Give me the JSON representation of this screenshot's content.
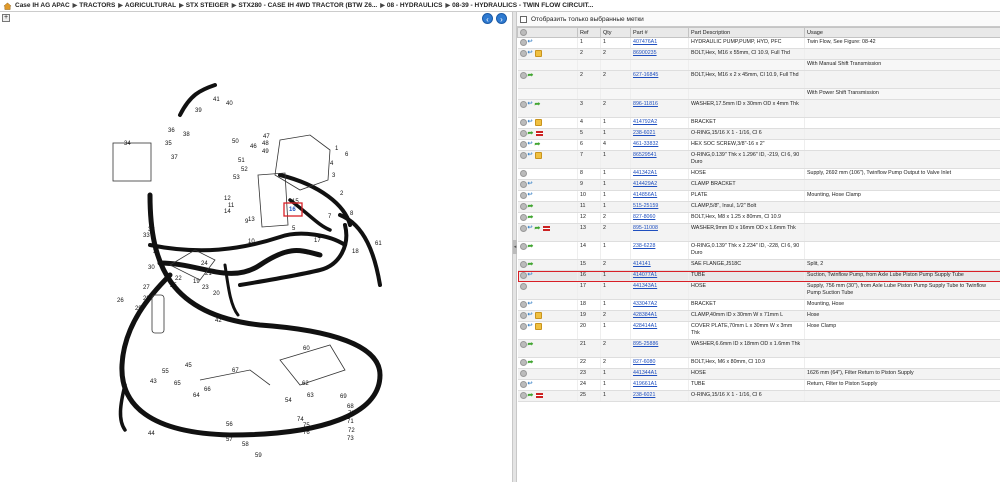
{
  "breadcrumb": [
    "Case IH AG APAC",
    "TRACTORS",
    "AGRICULTURAL",
    "STX STEIGER",
    "STX280 - CASE IH 4WD TRACTOR (BTW Z6...",
    "08 - HYDRAULICS",
    "08-39 - HYDRAULICS - TWIN FLOW CIRCUIT..."
  ],
  "filter_label": "Отобразить только выбранные метки",
  "columns": [
    "Ref",
    "Qty",
    "Part #",
    "Part Description",
    "Usage"
  ],
  "rows": [
    {
      "type": "part",
      "icons": [
        "info",
        "return"
      ],
      "ref": "1",
      "qty": "1",
      "part": "407476A1",
      "desc": "HYDRAULIC PUMP,PUMP, HYD, PFC",
      "usage": "Twin Flow, See Figure: 08-42"
    },
    {
      "type": "part",
      "icons": [
        "info",
        "return",
        "box"
      ],
      "ref": "2",
      "qty": "2",
      "part": "86900235",
      "desc": "BOLT,Hex, M16 x 55mm, Cl 10.9, Full Thd",
      "usage": ""
    },
    {
      "type": "note",
      "usage": "With Manual Shift Transmission"
    },
    {
      "type": "part",
      "tall": true,
      "icons": [
        "info",
        "arrow"
      ],
      "ref": "2",
      "qty": "2",
      "part": "627-16845",
      "desc": "BOLT,Hex, M16 x 2 x 45mm, Cl 10.9, Full Thd",
      "usage": ""
    },
    {
      "type": "note",
      "usage": "With Power Shift Transmission"
    },
    {
      "type": "part",
      "tall": true,
      "icons": [
        "info",
        "return",
        "arrow"
      ],
      "ref": "3",
      "qty": "2",
      "part": "896-11816",
      "desc": "WASHER,17.5mm ID x 30mm OD x 4mm Thk",
      "usage": ""
    },
    {
      "type": "part",
      "icons": [
        "info",
        "return",
        "box"
      ],
      "ref": "4",
      "qty": "1",
      "part": "414792A2",
      "desc": "BRACKET",
      "usage": ""
    },
    {
      "type": "part",
      "icons": [
        "info",
        "arrow",
        "flag"
      ],
      "ref": "5",
      "qty": "1",
      "part": "238-6021",
      "desc": "O-RING,15/16 X 1 - 1/16, Cl 6",
      "usage": ""
    },
    {
      "type": "part",
      "icons": [
        "info",
        "return",
        "arrow"
      ],
      "ref": "6",
      "qty": "4",
      "part": "461-33832",
      "desc": "HEX SOC SCREW,3/8\"-16 x 2\"",
      "usage": ""
    },
    {
      "type": "part",
      "tall": true,
      "icons": [
        "info",
        "return",
        "box"
      ],
      "ref": "7",
      "qty": "1",
      "part": "86529541",
      "desc": "O-RING,0.139\" Thk x 1.296\" ID, -219, Cl 6, 90 Duro",
      "usage": ""
    },
    {
      "type": "part",
      "icons": [
        "info"
      ],
      "ref": "8",
      "qty": "1",
      "part": "441342A1",
      "desc": "HOSE",
      "usage": "Supply, 2692 mm (106\"), Twinflow Pump Output to Valve Inlet"
    },
    {
      "type": "part",
      "icons": [
        "info",
        "return"
      ],
      "ref": "9",
      "qty": "1",
      "part": "414429A2",
      "desc": "CLAMP BRACKET",
      "usage": ""
    },
    {
      "type": "part",
      "icons": [
        "info",
        "return"
      ],
      "ref": "10",
      "qty": "1",
      "part": "414856A1",
      "desc": "PLATE",
      "usage": "Mounting, Hose Clamp"
    },
    {
      "type": "part",
      "icons": [
        "info",
        "arrow"
      ],
      "ref": "11",
      "qty": "1",
      "part": "515-25159",
      "desc": "CLAMP,5/8\", Insul, 1/2\" Bolt",
      "usage": ""
    },
    {
      "type": "part",
      "icons": [
        "info",
        "arrow"
      ],
      "ref": "12",
      "qty": "2",
      "part": "827-8060",
      "desc": "BOLT,Hex, M8 x 1.25 x 80mm, Cl 10.9",
      "usage": ""
    },
    {
      "type": "part",
      "tall": true,
      "icons": [
        "info",
        "return",
        "arrow",
        "flag"
      ],
      "ref": "13",
      "qty": "2",
      "part": "895-11008",
      "desc": "WASHER,9mm ID x 16mm OD x 1.6mm Thk",
      "usage": ""
    },
    {
      "type": "part",
      "tall": true,
      "icons": [
        "info",
        "arrow"
      ],
      "ref": "14",
      "qty": "1",
      "part": "238-6228",
      "desc": "O-RING,0.139\" Thk x 2.234\" ID, -228, Cl 6, 90 Duro",
      "usage": ""
    },
    {
      "type": "part",
      "icons": [
        "info",
        "arrow"
      ],
      "ref": "15",
      "qty": "2",
      "part": "414141",
      "desc": "SAE FLANGE,J518C",
      "usage": "Split, 2"
    },
    {
      "type": "part",
      "selected": true,
      "icons": [
        "info",
        "return"
      ],
      "ref": "16",
      "qty": "1",
      "part": "414077A1",
      "desc": "TUBE",
      "usage": "Suction, Twinflow Pump, from Axle Lube Piston Pump Supply Tube"
    },
    {
      "type": "part",
      "tall": true,
      "icons": [
        "info"
      ],
      "ref": "17",
      "qty": "1",
      "part": "441343A1",
      "desc": "HOSE",
      "usage": "Supply, 756 mm (30\"), from Axle Lube Piston Pump Supply Tube to Twinflow Pump Suction Tube"
    },
    {
      "type": "part",
      "icons": [
        "info",
        "return"
      ],
      "ref": "18",
      "qty": "1",
      "part": "433047A2",
      "desc": "BRACKET",
      "usage": "Mounting, Hose"
    },
    {
      "type": "part",
      "icons": [
        "info",
        "return",
        "box"
      ],
      "ref": "19",
      "qty": "2",
      "part": "428384A1",
      "desc": "CLAMP,40mm ID x 30mm W x 71mm L",
      "usage": "Hose"
    },
    {
      "type": "part",
      "tall": true,
      "icons": [
        "info",
        "return",
        "box"
      ],
      "ref": "20",
      "qty": "1",
      "part": "428414A1",
      "desc": "COVER PLATE,70mm L x 30mm W x 3mm Thk",
      "usage": "Hose Clamp"
    },
    {
      "type": "part",
      "tall": true,
      "icons": [
        "info",
        "arrow"
      ],
      "ref": "21",
      "qty": "2",
      "part": "895-25886",
      "desc": "WASHER,6.6mm ID x 18mm OD x 1.6mm Thk",
      "usage": ""
    },
    {
      "type": "part",
      "icons": [
        "info",
        "arrow"
      ],
      "ref": "22",
      "qty": "2",
      "part": "827-6080",
      "desc": "BOLT,Hex, M6 x 80mm, Cl 10.9",
      "usage": ""
    },
    {
      "type": "part",
      "icons": [
        "info"
      ],
      "ref": "23",
      "qty": "1",
      "part": "441344A1",
      "desc": "HOSE",
      "usage": "1626 mm (64\"), Filter Return to Piston Supply"
    },
    {
      "type": "part",
      "icons": [
        "info",
        "return"
      ],
      "ref": "24",
      "qty": "1",
      "part": "419661A1",
      "desc": "TUBE",
      "usage": "Return, Filter to Piston Supply"
    },
    {
      "type": "part",
      "icons": [
        "info",
        "arrow",
        "flag"
      ],
      "ref": "25",
      "qty": "1",
      "part": "238-6021",
      "desc": "O-RING,15/16 X 1 - 1/16, Cl 6",
      "usage": ""
    }
  ],
  "callouts": [
    "1",
    "2",
    "3",
    "4",
    "5",
    "6",
    "7",
    "8",
    "9",
    "10",
    "11",
    "12",
    "13",
    "14",
    "15",
    "16",
    "17",
    "18",
    "19",
    "20",
    "21",
    "22",
    "23",
    "24",
    "25",
    "26",
    "27",
    "28",
    "29",
    "30",
    "31",
    "32",
    "33",
    "34",
    "35",
    "36",
    "37",
    "38",
    "39",
    "40",
    "41",
    "42",
    "43",
    "44",
    "45",
    "46",
    "47",
    "48",
    "49",
    "50",
    "51",
    "52",
    "53",
    "54",
    "55",
    "56",
    "57",
    "58",
    "59",
    "60",
    "61",
    "62",
    "63",
    "64",
    "65",
    "66",
    "67",
    "68",
    "69",
    "70",
    "71",
    "72",
    "73",
    "74",
    "75",
    "76"
  ],
  "highlight_callout": "16",
  "colors": {
    "highlight": "#d81f26",
    "link": "#1f4fbf",
    "nav": "#2e7ad1"
  }
}
